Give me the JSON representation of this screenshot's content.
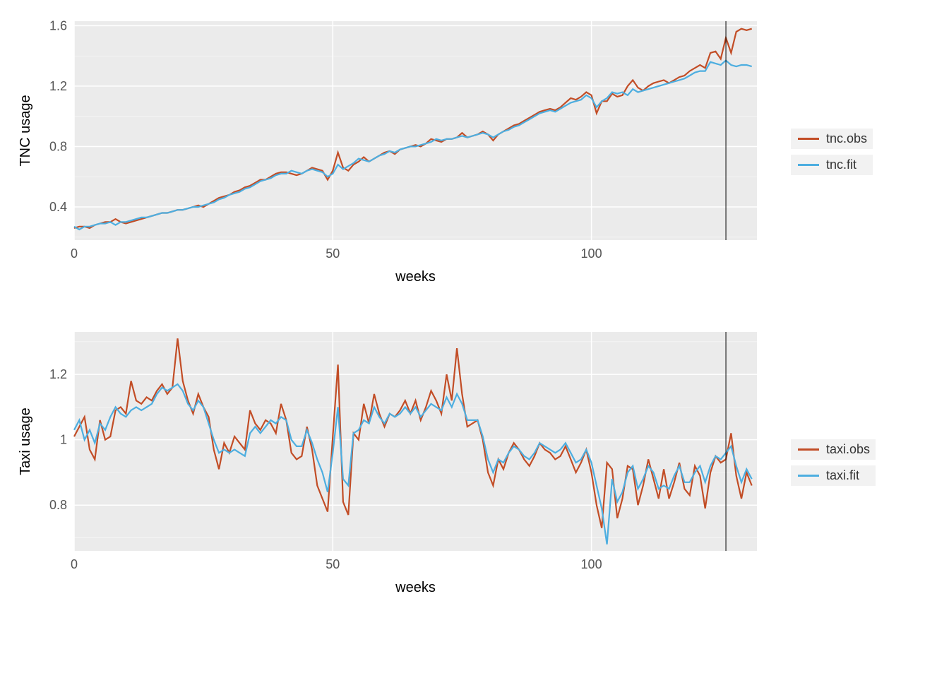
{
  "colors": {
    "obs": "#c24d26",
    "fit": "#4daee0"
  },
  "chart_data": [
    {
      "type": "line",
      "xlabel": "weeks",
      "ylabel": "TNC usage",
      "x_ticks": [
        0,
        50,
        100
      ],
      "y_ticks": [
        0.4,
        0.8,
        1.2,
        1.6
      ],
      "xlim": [
        0,
        132
      ],
      "ylim": [
        0.18,
        1.63
      ],
      "vline_x": 126,
      "legend": [
        {
          "name": "tnc.obs",
          "color_key": "obs"
        },
        {
          "name": "tnc.fit",
          "color_key": "fit"
        }
      ],
      "series": [
        {
          "name": "tnc.obs",
          "color_key": "obs",
          "x": [
            0,
            1,
            2,
            3,
            4,
            5,
            6,
            7,
            8,
            9,
            10,
            11,
            12,
            13,
            14,
            15,
            16,
            17,
            18,
            19,
            20,
            21,
            22,
            23,
            24,
            25,
            26,
            27,
            28,
            29,
            30,
            31,
            32,
            33,
            34,
            35,
            36,
            37,
            38,
            39,
            40,
            41,
            42,
            43,
            44,
            45,
            46,
            47,
            48,
            49,
            50,
            51,
            52,
            53,
            54,
            55,
            56,
            57,
            58,
            59,
            60,
            61,
            62,
            63,
            64,
            65,
            66,
            67,
            68,
            69,
            70,
            71,
            72,
            73,
            74,
            75,
            76,
            77,
            78,
            79,
            80,
            81,
            82,
            83,
            84,
            85,
            86,
            87,
            88,
            89,
            90,
            91,
            92,
            93,
            94,
            95,
            96,
            97,
            98,
            99,
            100,
            101,
            102,
            103,
            104,
            105,
            106,
            107,
            108,
            109,
            110,
            111,
            112,
            113,
            114,
            115,
            116,
            117,
            118,
            119,
            120,
            121,
            122,
            123,
            124,
            125,
            126,
            127,
            128,
            129,
            130,
            131
          ],
          "values": [
            0.26,
            0.27,
            0.27,
            0.26,
            0.28,
            0.29,
            0.3,
            0.3,
            0.32,
            0.3,
            0.29,
            0.3,
            0.31,
            0.32,
            0.33,
            0.34,
            0.35,
            0.36,
            0.36,
            0.37,
            0.38,
            0.38,
            0.39,
            0.4,
            0.41,
            0.4,
            0.42,
            0.44,
            0.46,
            0.47,
            0.48,
            0.5,
            0.51,
            0.53,
            0.54,
            0.56,
            0.58,
            0.58,
            0.6,
            0.62,
            0.63,
            0.63,
            0.62,
            0.61,
            0.62,
            0.64,
            0.66,
            0.65,
            0.64,
            0.58,
            0.64,
            0.76,
            0.66,
            0.64,
            0.68,
            0.7,
            0.73,
            0.7,
            0.72,
            0.74,
            0.76,
            0.77,
            0.75,
            0.78,
            0.79,
            0.8,
            0.81,
            0.8,
            0.82,
            0.85,
            0.84,
            0.83,
            0.85,
            0.85,
            0.86,
            0.89,
            0.86,
            0.87,
            0.88,
            0.9,
            0.88,
            0.84,
            0.88,
            0.9,
            0.92,
            0.94,
            0.95,
            0.97,
            0.99,
            1.01,
            1.03,
            1.04,
            1.05,
            1.04,
            1.06,
            1.09,
            1.12,
            1.11,
            1.13,
            1.16,
            1.14,
            1.02,
            1.1,
            1.1,
            1.15,
            1.13,
            1.14,
            1.2,
            1.24,
            1.19,
            1.17,
            1.2,
            1.22,
            1.23,
            1.24,
            1.22,
            1.24,
            1.26,
            1.27,
            1.3,
            1.32,
            1.34,
            1.32,
            1.42,
            1.43,
            1.38,
            1.52,
            1.42,
            1.56,
            1.58,
            1.57,
            1.58
          ]
        },
        {
          "name": "tnc.fit",
          "color_key": "fit",
          "x": [
            0,
            1,
            2,
            3,
            4,
            5,
            6,
            7,
            8,
            9,
            10,
            11,
            12,
            13,
            14,
            15,
            16,
            17,
            18,
            19,
            20,
            21,
            22,
            23,
            24,
            25,
            26,
            27,
            28,
            29,
            30,
            31,
            32,
            33,
            34,
            35,
            36,
            37,
            38,
            39,
            40,
            41,
            42,
            43,
            44,
            45,
            46,
            47,
            48,
            49,
            50,
            51,
            52,
            53,
            54,
            55,
            56,
            57,
            58,
            59,
            60,
            61,
            62,
            63,
            64,
            65,
            66,
            67,
            68,
            69,
            70,
            71,
            72,
            73,
            74,
            75,
            76,
            77,
            78,
            79,
            80,
            81,
            82,
            83,
            84,
            85,
            86,
            87,
            88,
            89,
            90,
            91,
            92,
            93,
            94,
            95,
            96,
            97,
            98,
            99,
            100,
            101,
            102,
            103,
            104,
            105,
            106,
            107,
            108,
            109,
            110,
            111,
            112,
            113,
            114,
            115,
            116,
            117,
            118,
            119,
            120,
            121,
            122,
            123,
            124,
            125,
            126,
            127,
            128,
            129,
            130,
            131
          ],
          "values": [
            0.27,
            0.25,
            0.27,
            0.27,
            0.28,
            0.29,
            0.29,
            0.3,
            0.28,
            0.3,
            0.3,
            0.31,
            0.32,
            0.33,
            0.33,
            0.34,
            0.35,
            0.36,
            0.36,
            0.37,
            0.38,
            0.38,
            0.39,
            0.4,
            0.4,
            0.41,
            0.42,
            0.43,
            0.45,
            0.46,
            0.48,
            0.49,
            0.5,
            0.52,
            0.53,
            0.55,
            0.57,
            0.58,
            0.59,
            0.61,
            0.62,
            0.62,
            0.64,
            0.63,
            0.62,
            0.64,
            0.65,
            0.64,
            0.63,
            0.6,
            0.62,
            0.68,
            0.65,
            0.67,
            0.69,
            0.72,
            0.71,
            0.7,
            0.72,
            0.74,
            0.75,
            0.77,
            0.76,
            0.78,
            0.79,
            0.8,
            0.8,
            0.81,
            0.82,
            0.83,
            0.85,
            0.84,
            0.85,
            0.85,
            0.86,
            0.87,
            0.86,
            0.87,
            0.88,
            0.89,
            0.88,
            0.86,
            0.88,
            0.9,
            0.91,
            0.93,
            0.94,
            0.96,
            0.98,
            1.0,
            1.02,
            1.03,
            1.04,
            1.03,
            1.05,
            1.07,
            1.09,
            1.1,
            1.11,
            1.14,
            1.12,
            1.06,
            1.1,
            1.12,
            1.16,
            1.15,
            1.16,
            1.14,
            1.18,
            1.16,
            1.17,
            1.18,
            1.19,
            1.2,
            1.21,
            1.22,
            1.23,
            1.24,
            1.25,
            1.27,
            1.29,
            1.3,
            1.3,
            1.36,
            1.35,
            1.34,
            1.37,
            1.34,
            1.33,
            1.34,
            1.34,
            1.33
          ]
        }
      ]
    },
    {
      "type": "line",
      "xlabel": "weeks",
      "ylabel": "Taxi usage",
      "x_ticks": [
        0,
        50,
        100
      ],
      "y_ticks": [
        0.8,
        1.0,
        1.2
      ],
      "xlim": [
        0,
        132
      ],
      "ylim": [
        0.66,
        1.33
      ],
      "vline_x": 126,
      "legend": [
        {
          "name": "taxi.obs",
          "color_key": "obs"
        },
        {
          "name": "taxi.fit",
          "color_key": "fit"
        }
      ],
      "series": [
        {
          "name": "taxi.obs",
          "color_key": "obs",
          "x": [
            0,
            1,
            2,
            3,
            4,
            5,
            6,
            7,
            8,
            9,
            10,
            11,
            12,
            13,
            14,
            15,
            16,
            17,
            18,
            19,
            20,
            21,
            22,
            23,
            24,
            25,
            26,
            27,
            28,
            29,
            30,
            31,
            32,
            33,
            34,
            35,
            36,
            37,
            38,
            39,
            40,
            41,
            42,
            43,
            44,
            45,
            46,
            47,
            48,
            49,
            50,
            51,
            52,
            53,
            54,
            55,
            56,
            57,
            58,
            59,
            60,
            61,
            62,
            63,
            64,
            65,
            66,
            67,
            68,
            69,
            70,
            71,
            72,
            73,
            74,
            75,
            76,
            77,
            78,
            79,
            80,
            81,
            82,
            83,
            84,
            85,
            86,
            87,
            88,
            89,
            90,
            91,
            92,
            93,
            94,
            95,
            96,
            97,
            98,
            99,
            100,
            101,
            102,
            103,
            104,
            105,
            106,
            107,
            108,
            109,
            110,
            111,
            112,
            113,
            114,
            115,
            116,
            117,
            118,
            119,
            120,
            121,
            122,
            123,
            124,
            125,
            126,
            127,
            128,
            129,
            130,
            131
          ],
          "values": [
            1.01,
            1.04,
            1.07,
            0.97,
            0.94,
            1.06,
            1.0,
            1.01,
            1.09,
            1.1,
            1.08,
            1.18,
            1.12,
            1.11,
            1.13,
            1.12,
            1.15,
            1.17,
            1.14,
            1.16,
            1.31,
            1.18,
            1.12,
            1.08,
            1.14,
            1.1,
            1.07,
            0.97,
            0.91,
            0.99,
            0.96,
            1.01,
            0.99,
            0.97,
            1.09,
            1.05,
            1.03,
            1.06,
            1.05,
            1.02,
            1.11,
            1.06,
            0.96,
            0.94,
            0.95,
            1.04,
            0.97,
            0.86,
            0.82,
            0.78,
            1.01,
            1.23,
            0.81,
            0.77,
            1.02,
            1.0,
            1.11,
            1.05,
            1.14,
            1.08,
            1.04,
            1.08,
            1.07,
            1.09,
            1.12,
            1.08,
            1.12,
            1.06,
            1.1,
            1.15,
            1.12,
            1.08,
            1.2,
            1.12,
            1.28,
            1.14,
            1.04,
            1.05,
            1.06,
            1.0,
            0.9,
            0.86,
            0.94,
            0.91,
            0.96,
            0.99,
            0.97,
            0.94,
            0.92,
            0.95,
            0.99,
            0.97,
            0.96,
            0.94,
            0.95,
            0.98,
            0.94,
            0.9,
            0.93,
            0.97,
            0.9,
            0.8,
            0.73,
            0.93,
            0.91,
            0.76,
            0.82,
            0.92,
            0.91,
            0.8,
            0.86,
            0.94,
            0.88,
            0.82,
            0.91,
            0.82,
            0.87,
            0.93,
            0.85,
            0.83,
            0.92,
            0.89,
            0.79,
            0.9,
            0.95,
            0.93,
            0.94,
            1.02,
            0.89,
            0.82,
            0.9,
            0.86
          ]
        },
        {
          "name": "taxi.fit",
          "color_key": "fit",
          "x": [
            0,
            1,
            2,
            3,
            4,
            5,
            6,
            7,
            8,
            9,
            10,
            11,
            12,
            13,
            14,
            15,
            16,
            17,
            18,
            19,
            20,
            21,
            22,
            23,
            24,
            25,
            26,
            27,
            28,
            29,
            30,
            31,
            32,
            33,
            34,
            35,
            36,
            37,
            38,
            39,
            40,
            41,
            42,
            43,
            44,
            45,
            46,
            47,
            48,
            49,
            50,
            51,
            52,
            53,
            54,
            55,
            56,
            57,
            58,
            59,
            60,
            61,
            62,
            63,
            64,
            65,
            66,
            67,
            68,
            69,
            70,
            71,
            72,
            73,
            74,
            75,
            76,
            77,
            78,
            79,
            80,
            81,
            82,
            83,
            84,
            85,
            86,
            87,
            88,
            89,
            90,
            91,
            92,
            93,
            94,
            95,
            96,
            97,
            98,
            99,
            100,
            101,
            102,
            103,
            104,
            105,
            106,
            107,
            108,
            109,
            110,
            111,
            112,
            113,
            114,
            115,
            116,
            117,
            118,
            119,
            120,
            121,
            122,
            123,
            124,
            125,
            126,
            127,
            128,
            129,
            130,
            131
          ],
          "values": [
            1.03,
            1.06,
            1.0,
            1.03,
            0.99,
            1.05,
            1.03,
            1.07,
            1.1,
            1.08,
            1.07,
            1.09,
            1.1,
            1.09,
            1.1,
            1.11,
            1.14,
            1.16,
            1.15,
            1.16,
            1.17,
            1.15,
            1.11,
            1.09,
            1.12,
            1.1,
            1.05,
            1.0,
            0.96,
            0.97,
            0.96,
            0.97,
            0.96,
            0.95,
            1.02,
            1.04,
            1.02,
            1.04,
            1.06,
            1.05,
            1.07,
            1.06,
            1.0,
            0.98,
            0.98,
            1.03,
            0.99,
            0.94,
            0.9,
            0.84,
            0.96,
            1.1,
            0.88,
            0.86,
            1.02,
            1.03,
            1.06,
            1.05,
            1.1,
            1.07,
            1.05,
            1.08,
            1.07,
            1.08,
            1.1,
            1.08,
            1.1,
            1.07,
            1.09,
            1.11,
            1.1,
            1.09,
            1.13,
            1.1,
            1.14,
            1.11,
            1.06,
            1.06,
            1.06,
            1.01,
            0.94,
            0.9,
            0.94,
            0.93,
            0.96,
            0.98,
            0.97,
            0.95,
            0.94,
            0.96,
            0.99,
            0.98,
            0.97,
            0.96,
            0.97,
            0.99,
            0.96,
            0.93,
            0.94,
            0.97,
            0.93,
            0.86,
            0.79,
            0.68,
            0.88,
            0.81,
            0.84,
            0.9,
            0.92,
            0.85,
            0.88,
            0.92,
            0.9,
            0.85,
            0.86,
            0.85,
            0.89,
            0.92,
            0.87,
            0.87,
            0.9,
            0.92,
            0.87,
            0.92,
            0.95,
            0.94,
            0.96,
            0.98,
            0.92,
            0.87,
            0.91,
            0.88
          ]
        }
      ]
    }
  ]
}
